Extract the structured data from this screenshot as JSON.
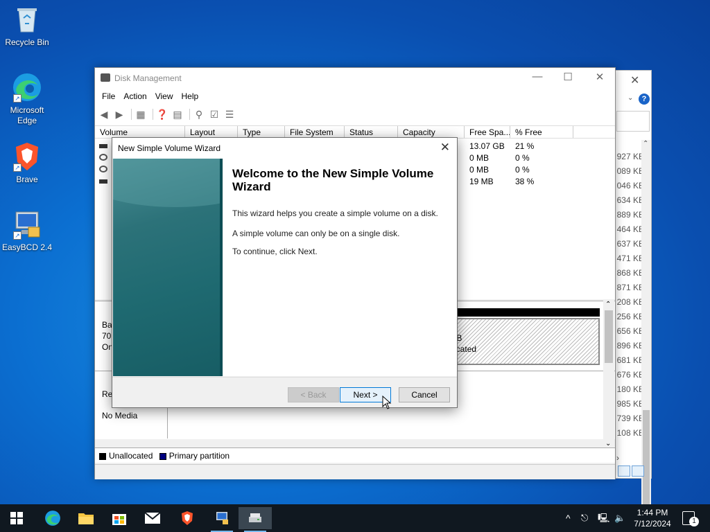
{
  "desktop": {
    "icons": [
      {
        "label": "Recycle Bin"
      },
      {
        "label": "Microsoft Edge"
      },
      {
        "label": "Brave"
      },
      {
        "label": "EasyBCD 2.4"
      }
    ]
  },
  "disk_management": {
    "title": "Disk Management",
    "menu": [
      "File",
      "Action",
      "View",
      "Help"
    ],
    "columns": [
      "Volume",
      "Layout",
      "Type",
      "File System",
      "Status",
      "Capacity",
      "Free Spa...",
      "% Free"
    ],
    "rows": [
      {
        "free": "13.07 GB",
        "pct": "21 %"
      },
      {
        "free": "0 MB",
        "pct": "0 %"
      },
      {
        "free": "0 MB",
        "pct": "0 %"
      },
      {
        "free": "19 MB",
        "pct": "38 %"
      }
    ],
    "disk0": {
      "line1": "Ba",
      "line2": "70.",
      "line3": "On"
    },
    "segment": {
      "size": "4 GB",
      "status": "allocated"
    },
    "disk1": {
      "line1": "Re",
      "no_media": "No Media"
    },
    "legend": [
      {
        "label": "Unallocated",
        "color": "#000000"
      },
      {
        "label": "Primary partition",
        "color": "#00007f"
      }
    ]
  },
  "explorer_fragment": {
    "sizes": [
      "927 KB",
      "089 KB",
      "046 KB",
      "634 KB",
      "889 KB",
      "464 KB",
      "637 KB",
      "471 KB",
      "868 KB",
      "871 KB",
      "208 KB",
      "256 KB",
      "656 KB",
      "896 KB",
      "681 KB",
      "676 KB",
      "180 KB",
      "985 KB",
      "739 KB",
      "108 KB"
    ]
  },
  "wizard": {
    "title": "New Simple Volume Wizard",
    "heading": "Welcome to the New Simple Volume Wizard",
    "p1": "This wizard helps you create a simple volume on a disk.",
    "p2": "A simple volume can only be on a single disk.",
    "p3": "To continue, click Next.",
    "back": "< Back",
    "next": "Next >",
    "cancel": "Cancel"
  },
  "taskbar": {
    "time": "1:44 PM",
    "date": "7/12/2024",
    "notification_count": "1"
  }
}
